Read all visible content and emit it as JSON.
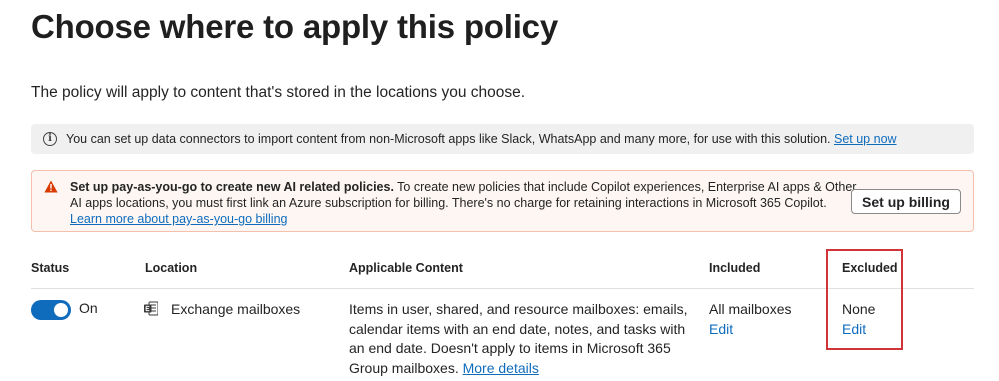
{
  "page": {
    "title": "Choose where to apply this policy",
    "subtitle": "The policy will apply to content that's stored in the locations you choose."
  },
  "info_bar": {
    "icon": "info-icon",
    "text": "You can set up data connectors to import content from non-Microsoft apps like Slack, WhatsApp and many more, for use with this solution.",
    "link": "Set up now"
  },
  "warning_bar": {
    "icon": "warning-icon",
    "bold_text": "Set up pay-as-you-go to create new AI related policies.",
    "text": "To create new policies that include Copilot experiences, Enterprise AI apps & Other AI apps locations, you must first link an Azure subscription for billing. There's no charge for retaining interactions in Microsoft 365 Copilot.",
    "link": "Learn more about pay-as-you-go billing",
    "button": "Set up billing",
    "colors": {
      "background": "#fdf6f3",
      "border": "#f4bfab",
      "icon": "#da3b01"
    }
  },
  "table": {
    "headers": {
      "status": "Status",
      "location": "Location",
      "content": "Applicable Content",
      "included": "Included",
      "excluded": "Excluded"
    },
    "rows": [
      {
        "status_label": "On",
        "status_on": true,
        "location_icon": "exchange-icon",
        "location": "Exchange mailboxes",
        "content": "Items in user, shared, and resource mailboxes: emails, calendar items with an end date, notes, and tasks with an end date. Doesn't apply to items in Microsoft 365 Group mailboxes.",
        "content_link": "More details",
        "included": "All mailboxes",
        "included_action": "Edit",
        "excluded": "None",
        "excluded_action": "Edit"
      }
    ]
  },
  "colors": {
    "accent": "#0f6cbd",
    "highlight": "#d13438"
  }
}
